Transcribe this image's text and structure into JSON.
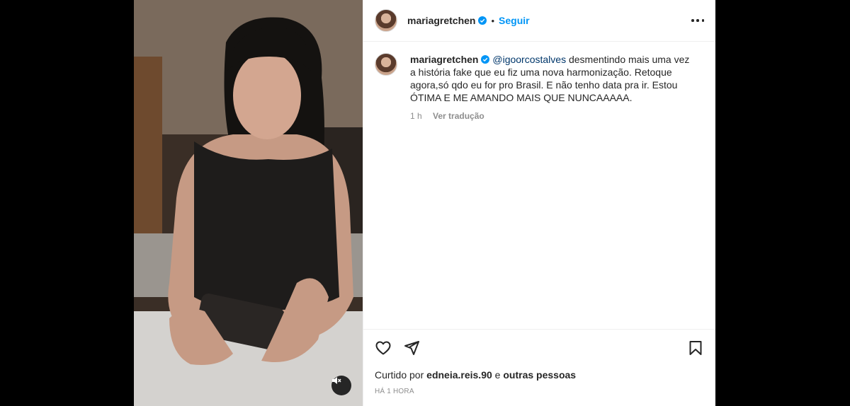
{
  "post": {
    "author": "mariagretchen",
    "follow_label": "Seguir",
    "separator": "•",
    "caption": {
      "mention": "@igoorcostalves",
      "text": " desmentindo mais uma vez a história fake que eu fiz uma nova harmonização. Retoque agora,só qdo eu for pro Brasil. E não tenho data pra ir. Estou ÓTIMA E ME AMANDO MAIS QUE NUNCAAAAA.",
      "age": "1 h",
      "translate_label": "Ver tradução"
    },
    "likes": {
      "prefix": "Curtido por ",
      "user": "edneia.reis.90",
      "connector": " e ",
      "suffix": "outras pessoas"
    },
    "timestamp": "HÁ 1 HORA"
  },
  "icons": {
    "verified": "verified-badge-icon",
    "more": "more-options-icon",
    "like": "heart-icon",
    "share": "send-icon",
    "save": "bookmark-icon",
    "mute": "muted-speaker-icon"
  },
  "colors": {
    "accent": "#0095f6",
    "mention": "#00376b",
    "text": "#262626",
    "muted": "#8e8e8e"
  }
}
